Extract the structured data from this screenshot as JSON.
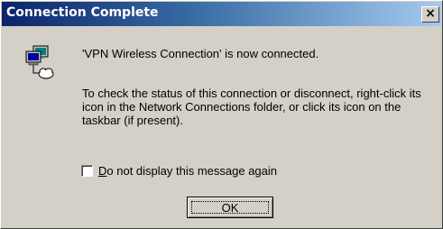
{
  "window": {
    "title": "Connection Complete",
    "close_glyph": "×"
  },
  "icon": "network-connection-icon",
  "message": {
    "connected": "'VPN Wireless Connection' is now connected.",
    "instructions": "To check the status of this connection or disconnect, right-click its icon in the Network Connections folder, or click its icon on the taskbar (if present)."
  },
  "checkbox": {
    "label_accel": "D",
    "label_rest": "o not display this message again",
    "checked": false
  },
  "buttons": {
    "ok_label": "OK"
  },
  "colors": {
    "titlebar_start": "#0a246a",
    "titlebar_end": "#a6caf0",
    "dialog_bg": "#d4d0c8"
  }
}
